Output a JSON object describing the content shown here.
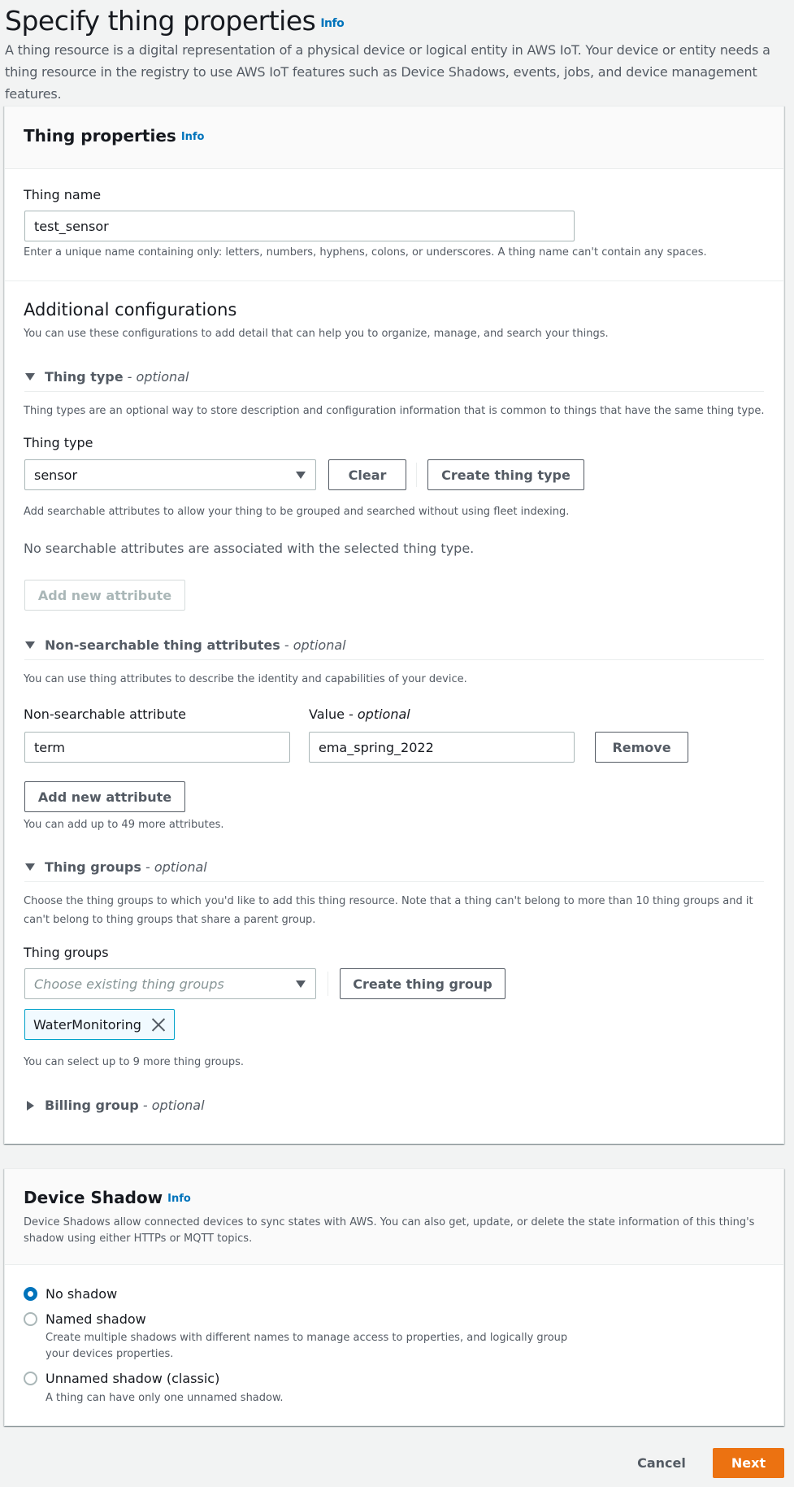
{
  "page": {
    "title": "Specify thing properties",
    "info_label": "Info",
    "description": "A thing resource is a digital representation of a physical device or logical entity in AWS IoT. Your device or entity needs a thing resource in the registry to use AWS IoT features such as Device Shadows, events, jobs, and device management features."
  },
  "thing_properties": {
    "title": "Thing properties",
    "info_label": "Info",
    "thing_name_label": "Thing name",
    "thing_name_value": "test_sensor",
    "thing_name_hint": "Enter a unique name containing only: letters, numbers, hyphens, colons, or underscores. A thing name can't contain any spaces."
  },
  "additional": {
    "title": "Additional configurations",
    "description": "You can use these configurations to add detail that can help you to organize, manage, and search your things.",
    "optional_suffix": "optional",
    "thing_type": {
      "header": "Thing type",
      "expanded": true,
      "description": "Thing types are an optional way to store description and configuration information that is common to things that have the same thing type.",
      "label": "Thing type",
      "selected": "sensor",
      "clear_button": "Clear",
      "create_button": "Create thing type",
      "searchable_hint": "Add searchable attributes to allow your thing to be grouped and searched without using fleet indexing.",
      "no_attributes_text": "No searchable attributes are associated with the selected thing type.",
      "add_attribute_button": "Add new attribute",
      "add_attribute_disabled": true
    },
    "non_searchable": {
      "header": "Non-searchable thing attributes",
      "expanded": true,
      "description": "You can use thing attributes to describe the identity and capabilities of your device.",
      "attribute_label": "Non-searchable attribute",
      "value_label": "Value",
      "attributes": [
        {
          "key": "term",
          "value": "ema_spring_2022"
        }
      ],
      "remove_button": "Remove",
      "add_attribute_button": "Add new attribute",
      "limit_hint": "You can add up to 49 more attributes."
    },
    "thing_groups": {
      "header": "Thing groups",
      "expanded": true,
      "description": "Choose the thing groups to which you'd like to add this thing resource. Note that a thing can't belong to more than 10 thing groups and it can't belong to thing groups that share a parent group.",
      "label": "Thing groups",
      "placeholder": "Choose existing thing groups",
      "create_button": "Create thing group",
      "selected_groups": [
        "WaterMonitoring"
      ],
      "limit_hint": "You can select up to 9 more thing groups."
    },
    "billing_group": {
      "header": "Billing group",
      "expanded": false
    }
  },
  "device_shadow": {
    "title": "Device Shadow",
    "info_label": "Info",
    "description": "Device Shadows allow connected devices to sync states with AWS. You can also get, update, or delete the state information of this thing's shadow using either HTTPs or MQTT topics.",
    "options": [
      {
        "label": "No shadow",
        "description": "",
        "checked": true
      },
      {
        "label": "Named shadow",
        "description": "Create multiple shadows with different names to manage access to properties, and logically group your devices properties.",
        "checked": false
      },
      {
        "label": "Unnamed shadow (classic)",
        "description": "A thing can have only one unnamed shadow.",
        "checked": false
      }
    ]
  },
  "footer": {
    "cancel_button": "Cancel",
    "next_button": "Next"
  },
  "colors": {
    "accent": "#0073bb",
    "primary_button": "#ec7211",
    "tag_border": "#00a1c9",
    "page_bg": "#f2f3f3"
  }
}
